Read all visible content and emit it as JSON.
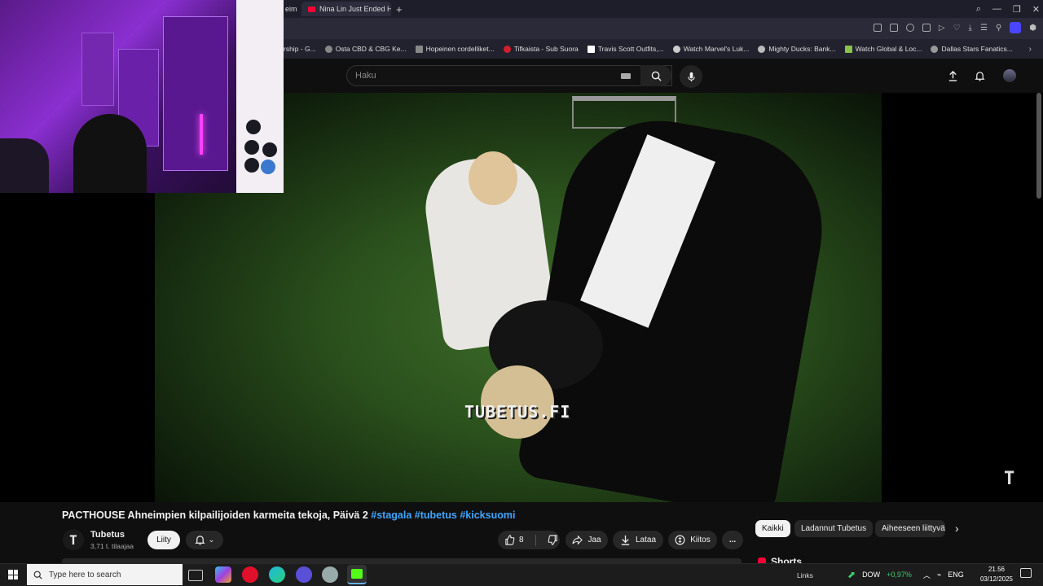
{
  "browser": {
    "tabs": [
      {
        "label": "eim",
        "active": false
      },
      {
        "label": "Nina Lin Just Ended Her C",
        "active": true
      }
    ],
    "new_tab": "+",
    "window_controls": [
      "minimize",
      "restore",
      "close"
    ]
  },
  "bookmarks": [
    {
      "label": "rship - G..."
    },
    {
      "label": "Osta CBD & CBG Ke..."
    },
    {
      "label": "Hopeinen cordelliket..."
    },
    {
      "label": "Tifkaista - Sub Suora"
    },
    {
      "label": "Travis Scott Outfits,..."
    },
    {
      "label": "Watch Marvel's Luk..."
    },
    {
      "label": "Mighty Ducks: Bank..."
    },
    {
      "label": "Watch Global & Loc..."
    },
    {
      "label": "Dallas Stars Fanatics..."
    }
  ],
  "youtube": {
    "search_placeholder": "Haku",
    "video": {
      "watermark": "TUBETUS.FI",
      "overlay_logo": "T"
    },
    "title_main": "PACTHOUSE Ahneimpien kilpailijoiden karmeita tekoja, Päivä 2 ",
    "title_tags": "#stagala #tubetus #kicksuomi",
    "channel": {
      "avatar_letter": "T",
      "name": "Tubetus",
      "subscribers": "3,71 t. tilaajaa",
      "join_label": "Liity"
    },
    "actions": {
      "like_count": "8",
      "share_label": "Jaa",
      "download_label": "Lataa",
      "thanks_label": "Kiitos",
      "more_label": "..."
    },
    "chips": [
      {
        "label": "Kaikki",
        "selected": true
      },
      {
        "label": "Ladannut Tubetus",
        "selected": false
      },
      {
        "label": "Aiheeseen liittyvä",
        "selected": false
      }
    ],
    "shorts_label": "Shorts"
  },
  "taskbar": {
    "search_placeholder": "Type here to search",
    "links_label": "Links",
    "ticker_name": "DOW",
    "ticker_change": "+0,97%",
    "language": "ENG",
    "time": "21.56",
    "date": "03/12/2025"
  },
  "colors": {
    "accent_link": "#3ea6ff",
    "ticker_up": "#3cd070",
    "youtube_red": "#ff0033"
  }
}
